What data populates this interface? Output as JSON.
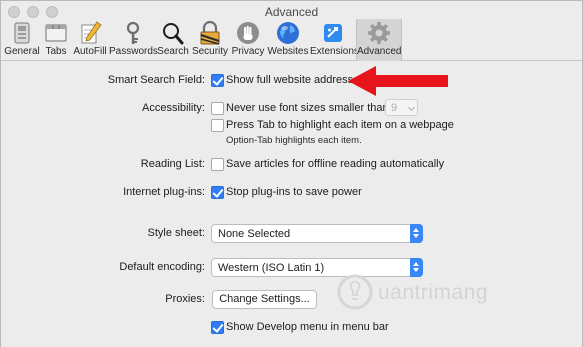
{
  "window": {
    "title": "Advanced"
  },
  "toolbar": {
    "items": [
      {
        "label": "General",
        "icon": "general-icon",
        "active": false
      },
      {
        "label": "Tabs",
        "icon": "tabs-icon",
        "active": false
      },
      {
        "label": "AutoFill",
        "icon": "autofill-icon",
        "active": false
      },
      {
        "label": "Passwords",
        "icon": "passwords-icon",
        "active": false
      },
      {
        "label": "Search",
        "icon": "search-icon",
        "active": false
      },
      {
        "label": "Security",
        "icon": "security-icon",
        "active": false
      },
      {
        "label": "Privacy",
        "icon": "privacy-icon",
        "active": false
      },
      {
        "label": "Websites",
        "icon": "websites-icon",
        "active": false
      },
      {
        "label": "Extensions",
        "icon": "extensions-icon",
        "active": false
      },
      {
        "label": "Advanced",
        "icon": "advanced-gear-icon",
        "active": true
      }
    ]
  },
  "settings": {
    "smart_search": {
      "label": "Smart Search Field:",
      "option": "Show full website address",
      "checked": true
    },
    "accessibility": {
      "label": "Accessibility:",
      "font_option": "Never use font sizes smaller than",
      "font_size": "9",
      "font_checked": false,
      "tab_option": "Press Tab to highlight each item on a webpage",
      "tab_checked": false,
      "tab_note": "Option-Tab highlights each item."
    },
    "reading_list": {
      "label": "Reading List:",
      "option": "Save articles for offline reading automatically",
      "checked": false
    },
    "plugins": {
      "label": "Internet plug-ins:",
      "option": "Stop plug-ins to save power",
      "checked": true
    },
    "style_sheet": {
      "label": "Style sheet:",
      "value": "None Selected"
    },
    "encoding": {
      "label": "Default encoding:",
      "value": "Western (ISO Latin 1)"
    },
    "proxies": {
      "label": "Proxies:",
      "button": "Change Settings..."
    },
    "develop": {
      "option": "Show Develop menu in menu bar",
      "checked": true
    }
  },
  "watermark": {
    "text": "uantrimang"
  },
  "colors": {
    "accent": "#2f7df6",
    "arrow": "#e8141b"
  }
}
